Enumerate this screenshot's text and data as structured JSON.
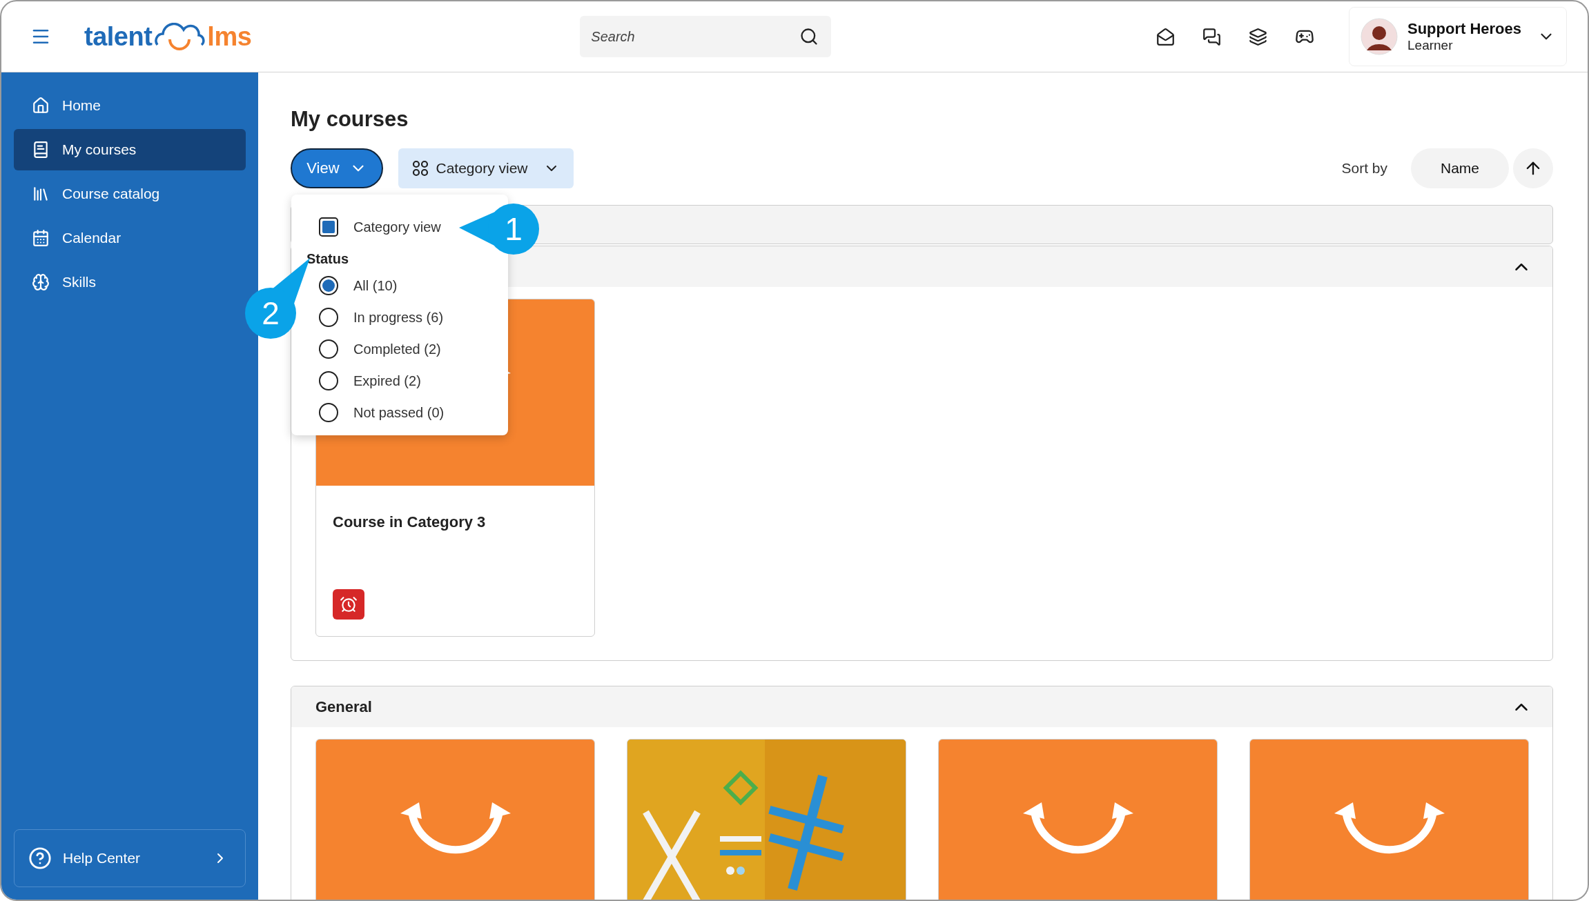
{
  "header": {
    "logo": {
      "left": "talent",
      "right": "lms"
    },
    "search": {
      "placeholder": "Search"
    },
    "user": {
      "name": "Support Heroes",
      "role": "Learner"
    }
  },
  "sidebar": {
    "items": [
      {
        "label": "Home",
        "selected": false
      },
      {
        "label": "My courses",
        "selected": true
      },
      {
        "label": "Course catalog",
        "selected": false
      },
      {
        "label": "Calendar",
        "selected": false
      },
      {
        "label": "Skills",
        "selected": false
      }
    ],
    "help": {
      "label": "Help Center"
    }
  },
  "page": {
    "title": "My courses",
    "view_button": {
      "label": "View",
      "open": true
    },
    "category_view_button": {
      "label": "Category view"
    },
    "sort": {
      "label": "Sort by",
      "value": "Name"
    }
  },
  "view_menu": {
    "category_view": {
      "label": "Category view",
      "checked": true
    },
    "status_heading": "Status",
    "statuses": [
      {
        "label": "All (10)",
        "selected": true
      },
      {
        "label": "In progress (6)",
        "selected": false
      },
      {
        "label": "Completed (2)",
        "selected": false
      },
      {
        "label": "Expired (2)",
        "selected": false
      },
      {
        "label": "Not passed (0)",
        "selected": false
      }
    ]
  },
  "categories": [
    {
      "expanded": true,
      "courses": [
        {
          "kind": "default",
          "title": "Course in Category 3",
          "expired": true
        }
      ]
    },
    {
      "title": "General",
      "expanded": true,
      "courses": [
        {
          "kind": "default"
        },
        {
          "kind": "picture"
        },
        {
          "kind": "default"
        },
        {
          "kind": "default"
        }
      ]
    }
  ],
  "callouts": [
    {
      "number": "1"
    },
    {
      "number": "2"
    }
  ]
}
